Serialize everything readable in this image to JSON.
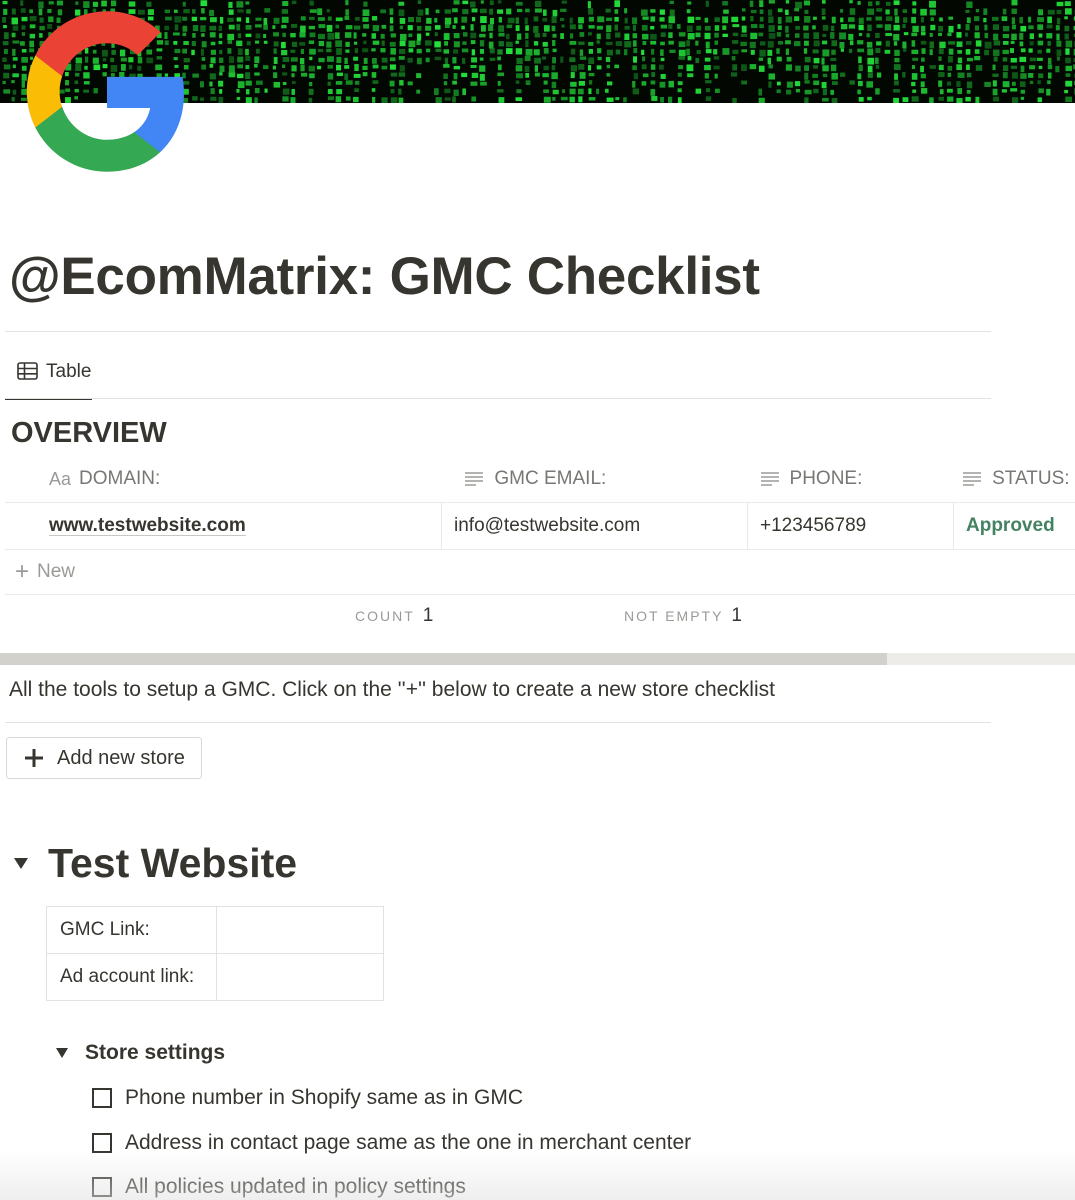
{
  "page": {
    "title": "@EcomMatrix: GMC Checklist",
    "description": "All the tools to setup a GMC. Click on the ''+'' below to create a new store checklist"
  },
  "cover": {
    "theme": "green-matrix-code",
    "colors": {
      "background": "#020702",
      "glyph": "#23e03a"
    }
  },
  "icon": {
    "name": "google-logo-icon"
  },
  "database": {
    "view_tab": {
      "label": "Table",
      "icon": "table-icon"
    },
    "title": "OVERVIEW",
    "columns": [
      {
        "label": "DOMAIN:",
        "icon": "title-property-icon",
        "icon_text": "Aa"
      },
      {
        "label": "GMC EMAIL:",
        "icon": "text-property-icon"
      },
      {
        "label": "PHONE:",
        "icon": "text-property-icon"
      },
      {
        "label": "STATUS:",
        "icon": "text-property-icon"
      }
    ],
    "rows": [
      {
        "domain": "www.testwebsite.com",
        "gmc_email": "info@testwebsite.com",
        "phone": "+123456789",
        "status": "Approved"
      }
    ],
    "new_row_label": "New",
    "calculations": [
      {
        "label": "COUNT",
        "value": "1"
      },
      {
        "label": "NOT EMPTY",
        "value": "1"
      }
    ],
    "status_color": "#448361"
  },
  "add_button": {
    "label": "Add new store"
  },
  "store": {
    "heading": "Test Website",
    "info_table": [
      {
        "label": "GMC Link:",
        "value": ""
      },
      {
        "label": "Ad account link:",
        "value": ""
      }
    ],
    "settings": {
      "heading": "Store settings",
      "items": [
        {
          "label": "Phone number in Shopify same as in GMC",
          "checked": false
        },
        {
          "label": "Address in contact page same as the one in merchant center",
          "checked": false
        },
        {
          "label": "All policies updated in policy settings",
          "checked": false
        }
      ]
    }
  }
}
